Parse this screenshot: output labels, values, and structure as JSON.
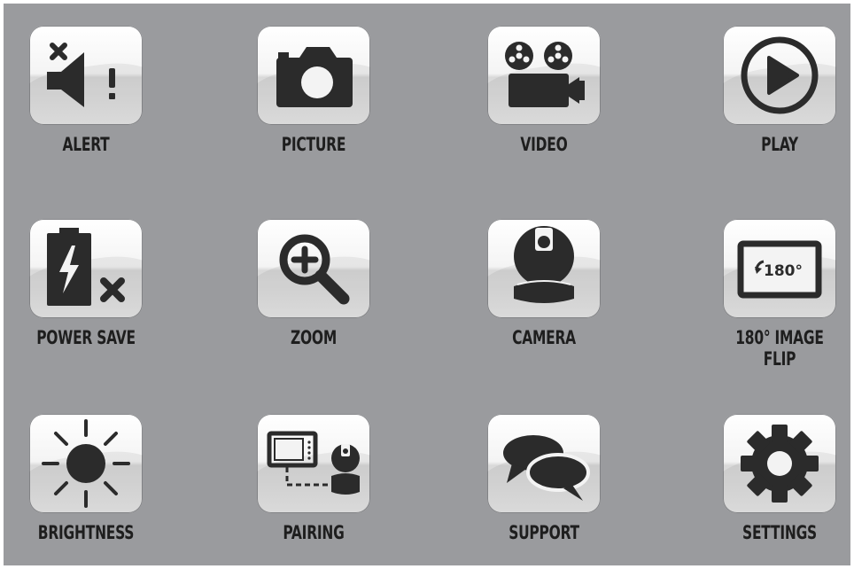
{
  "menu": {
    "items": [
      {
        "label": "ALERT",
        "icon": "alert-mute-icon"
      },
      {
        "label": "PICTURE",
        "icon": "camera-icon"
      },
      {
        "label": "VIDEO",
        "icon": "video-camera-icon"
      },
      {
        "label": "PLAY",
        "icon": "play-icon"
      },
      {
        "label": "POWER SAVE",
        "icon": "battery-off-icon"
      },
      {
        "label": "ZOOM",
        "icon": "zoom-in-icon"
      },
      {
        "label": "CAMERA",
        "icon": "ptz-camera-icon"
      },
      {
        "label": "180° IMAGE\nFLIP",
        "icon": "image-flip-icon",
        "icon_text": "180°"
      },
      {
        "label": "BRIGHTNESS",
        "icon": "sun-icon"
      },
      {
        "label": "PAIRING",
        "icon": "pairing-icon"
      },
      {
        "label": "SUPPORT",
        "icon": "chat-bubbles-icon"
      },
      {
        "label": "SETTINGS",
        "icon": "gear-icon"
      }
    ]
  },
  "colors": {
    "background": "#9a9b9e",
    "icon_fill": "#2b2b2b",
    "label": "#1e1e1e"
  }
}
